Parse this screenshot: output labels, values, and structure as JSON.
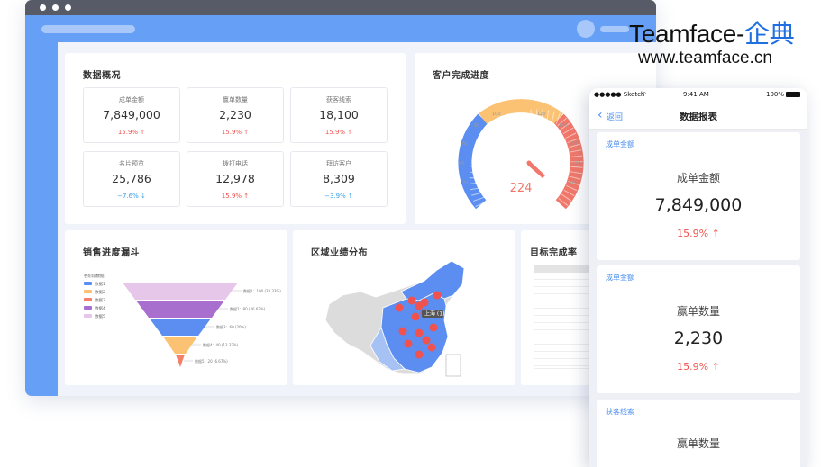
{
  "brand": {
    "name": "Teamface-",
    "name_cn": "企典",
    "url": "www.teamface.cn"
  },
  "overview": {
    "title": "数据概况",
    "tiles": [
      {
        "label": "成单金额",
        "value": "7,849,000",
        "change": "15.9% ↑",
        "trend": "up"
      },
      {
        "label": "赢单数量",
        "value": "2,230",
        "change": "15.9% ↑",
        "trend": "up"
      },
      {
        "label": "获客线索",
        "value": "18,100",
        "change": "15.9% ↑",
        "trend": "up"
      },
      {
        "label": "名片预览",
        "value": "25,786",
        "change": "−7.6% ↓",
        "trend": "down"
      },
      {
        "label": "拨打电话",
        "value": "12,978",
        "change": "15.9% ↑",
        "trend": "up"
      },
      {
        "label": "拜访客户",
        "value": "8,309",
        "change": "−3.9% ↑",
        "trend": "down"
      }
    ]
  },
  "gauge": {
    "title": "客户完成进度",
    "value": "224",
    "ticks": [
      "20",
      "40",
      "60",
      "80",
      "100",
      "120",
      "140",
      "160",
      "180",
      "200"
    ]
  },
  "funnel": {
    "title": "销售进度漏斗",
    "legend_title": "各阶段数据",
    "legend": [
      "数据1",
      "数据2",
      "数据3",
      "数据4",
      "数据5"
    ],
    "callouts": [
      "数据1：100 (33.33%)",
      "数据2：80 (26.67%)",
      "数据3：60 (20%)",
      "数据4：40 (13.33%)",
      "数据5：20 (6.67%)"
    ],
    "colors": [
      "#e6c6e9",
      "#a96fce",
      "#5b8ef0",
      "#fbc273",
      "#f4806a"
    ]
  },
  "map": {
    "title": "区域业绩分布",
    "tooltip": "上海 (1)"
  },
  "target": {
    "title": "目标完成率"
  },
  "phone": {
    "carrier": "●●●●● Sketch",
    "time": "9:41 AM",
    "battery": "100%",
    "back_label": "返回",
    "title": "数据报表",
    "cards": [
      {
        "tag": "成单金额",
        "label": "成单金额",
        "value": "7,849,000",
        "change": "15.9%  ↑"
      },
      {
        "tag": "成单金额",
        "label": "赢单数量",
        "value": "2,230",
        "change": "15.9%  ↑"
      },
      {
        "tag": "获客线索",
        "label": "赢单数量"
      }
    ]
  },
  "colors": {
    "accent": "#659ff6",
    "up": "#f0524f",
    "down": "#3aa1e6",
    "gauge_blue": "#5b8ef0",
    "gauge_orange": "#fbc273",
    "gauge_red": "#f0776a"
  }
}
